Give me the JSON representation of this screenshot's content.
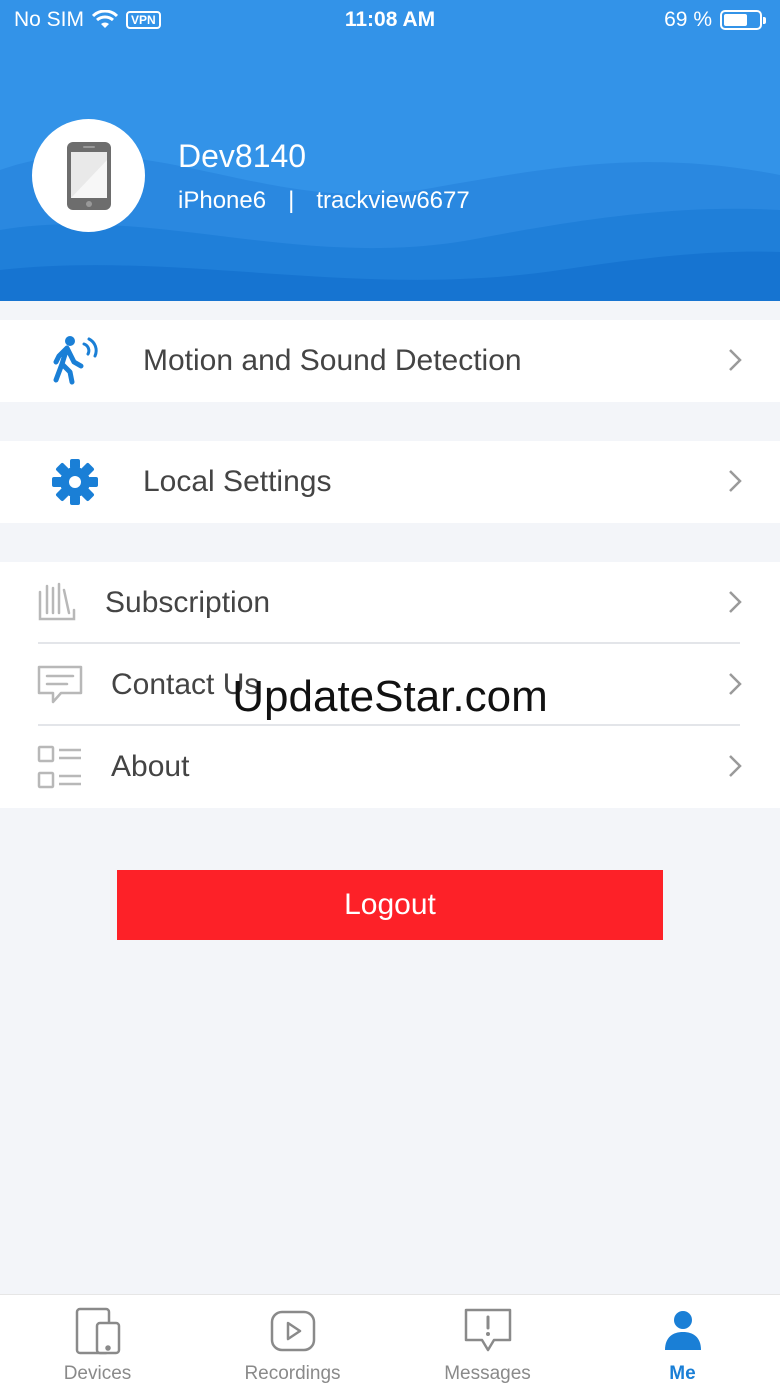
{
  "status_bar": {
    "carrier": "No SIM",
    "vpn": "VPN",
    "time": "11:08 AM",
    "battery_percent": "69 %",
    "battery_level": 0.69
  },
  "profile": {
    "device_name": "Dev8140",
    "model": "iPhone6",
    "separator": "|",
    "account": "trackview6677"
  },
  "menu": {
    "motion": {
      "label": "Motion and Sound Detection",
      "icon": "walking-person-icon"
    },
    "local_settings": {
      "label": "Local Settings",
      "icon": "gear-icon"
    },
    "subscription": {
      "label": "Subscription",
      "icon": "books-icon"
    },
    "contact": {
      "label": "Contact Us",
      "icon": "chat-message-icon"
    },
    "about": {
      "label": "About",
      "icon": "list-icon"
    }
  },
  "logout_label": "Logout",
  "watermark": "UpdateStar.com",
  "tabs": [
    {
      "label": "Devices",
      "icon": "devices-icon",
      "active": false
    },
    {
      "label": "Recordings",
      "icon": "play-icon",
      "active": false
    },
    {
      "label": "Messages",
      "icon": "alert-message-icon",
      "active": false
    },
    {
      "label": "Me",
      "icon": "person-icon",
      "active": true
    }
  ],
  "colors": {
    "header_blue": "#2f8fe6",
    "accent_blue": "#1a7fd6",
    "logout_red": "#fd2128"
  }
}
